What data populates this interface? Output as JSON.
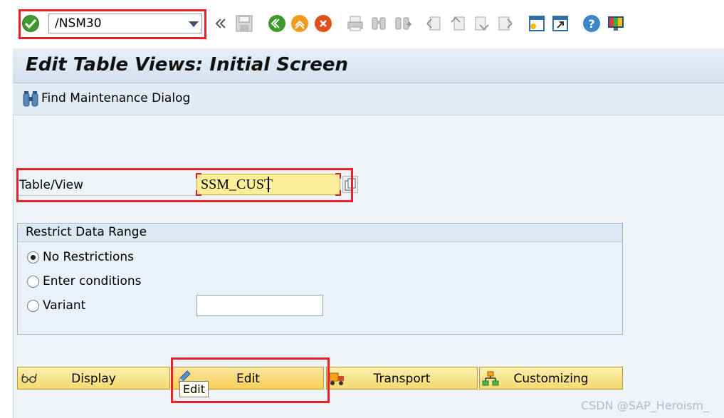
{
  "toolbar": {
    "command_value": "/NSM30",
    "icons": [
      "ok-check",
      "back-double-arrow",
      "save",
      "back-green",
      "exit-up",
      "cancel-red",
      "print",
      "find",
      "find-next",
      "first-page",
      "previous-page",
      "next-page",
      "last-page",
      "create-session",
      "generate-shortcut",
      "help",
      "customize-layout"
    ]
  },
  "screen": {
    "title": "Edit Table Views: Initial Screen",
    "find_maintenance_label": "Find Maintenance Dialog"
  },
  "form": {
    "table_view_label": "Table/View",
    "table_view_value": "SSM_CUST"
  },
  "restrict": {
    "title": "Restrict Data Range",
    "options": [
      {
        "label": "No Restrictions",
        "selected": true
      },
      {
        "label": "Enter conditions",
        "selected": false
      },
      {
        "label": "Variant",
        "selected": false
      }
    ],
    "variant_value": ""
  },
  "buttons": {
    "display": "Display",
    "edit": "Edit",
    "transport": "Transport",
    "customizing": "Customizing"
  },
  "tooltip": "Edit",
  "watermark": "CSDN @SAP_Heroism_",
  "colors": {
    "highlight_red": "#e8202a",
    "field_yellow": "#fdee9a",
    "button_yellow": "#f3d96c"
  }
}
